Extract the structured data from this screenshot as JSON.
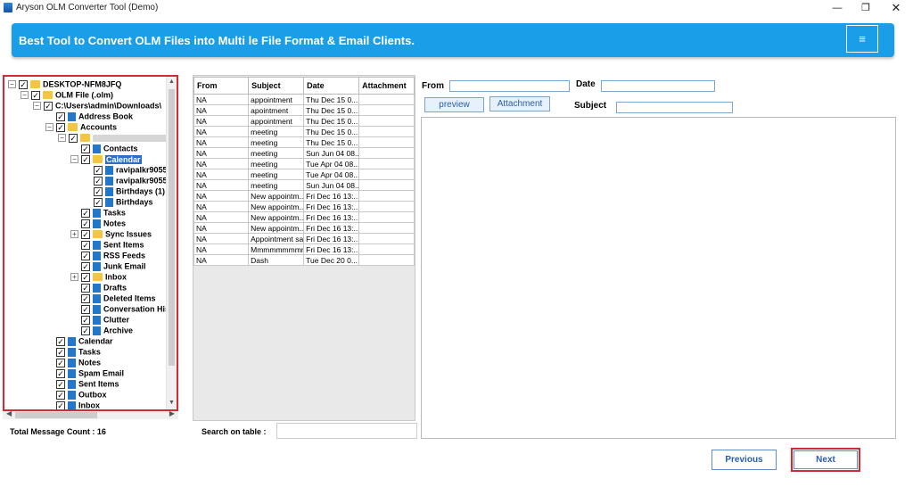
{
  "window": {
    "title": "Aryson OLM Converter Tool (Demo)",
    "minimize_glyph": "—",
    "maximize_glyph": "❐",
    "close_glyph": "✕"
  },
  "banner": {
    "text": "Best Tool to Convert OLM Files into Multi le File Format & Email Clients.",
    "menu_glyph": "≡"
  },
  "tree": {
    "nodes": [
      {
        "label": "DESKTOP-NFM8JFQ",
        "depth": 0,
        "expander": "minus",
        "icon": "folder-yellow",
        "checked": true
      },
      {
        "label": "OLM File (.olm)",
        "depth": 1,
        "expander": "minus",
        "icon": "folder-yellow",
        "checked": true
      },
      {
        "label": "C:\\Users\\admin\\Downloads\\",
        "depth": 2,
        "expander": "minus",
        "icon": "none",
        "checked": true
      },
      {
        "label": "Address Book",
        "depth": 3,
        "expander": "none",
        "icon": "folder-blue",
        "checked": true
      },
      {
        "label": "Accounts",
        "depth": 3,
        "expander": "minus",
        "icon": "folder-yellow",
        "checked": true
      },
      {
        "label": "",
        "depth": 4,
        "expander": "minus",
        "icon": "folder-yellow",
        "checked": true,
        "blurred": true
      },
      {
        "label": "Contacts",
        "depth": 5,
        "expander": "none",
        "icon": "folder-blue",
        "checked": true
      },
      {
        "label": "Calendar",
        "depth": 5,
        "expander": "minus",
        "icon": "folder-yellow",
        "checked": true,
        "selected": true
      },
      {
        "label": "ravipalkr9055",
        "depth": 6,
        "expander": "none",
        "icon": "folder-blue",
        "checked": true
      },
      {
        "label": "ravipalkr9055",
        "depth": 6,
        "expander": "none",
        "icon": "folder-blue",
        "checked": true
      },
      {
        "label": "Birthdays (1)",
        "depth": 6,
        "expander": "none",
        "icon": "folder-blue",
        "checked": true
      },
      {
        "label": "Birthdays",
        "depth": 6,
        "expander": "none",
        "icon": "folder-blue",
        "checked": true
      },
      {
        "label": "Tasks",
        "depth": 5,
        "expander": "none",
        "icon": "folder-blue",
        "checked": true
      },
      {
        "label": "Notes",
        "depth": 5,
        "expander": "none",
        "icon": "folder-blue",
        "checked": true
      },
      {
        "label": "Sync Issues",
        "depth": 5,
        "expander": "plus",
        "icon": "folder-yellow",
        "checked": true
      },
      {
        "label": "Sent Items",
        "depth": 5,
        "expander": "none",
        "icon": "folder-blue",
        "checked": true
      },
      {
        "label": "RSS Feeds",
        "depth": 5,
        "expander": "none",
        "icon": "folder-blue",
        "checked": true
      },
      {
        "label": "Junk Email",
        "depth": 5,
        "expander": "none",
        "icon": "folder-blue",
        "checked": true
      },
      {
        "label": "Inbox",
        "depth": 5,
        "expander": "plus",
        "icon": "folder-yellow",
        "checked": true
      },
      {
        "label": "Drafts",
        "depth": 5,
        "expander": "none",
        "icon": "folder-blue",
        "checked": true
      },
      {
        "label": "Deleted Items",
        "depth": 5,
        "expander": "none",
        "icon": "folder-blue",
        "checked": true
      },
      {
        "label": "Conversation Hist",
        "depth": 5,
        "expander": "none",
        "icon": "folder-blue",
        "checked": true
      },
      {
        "label": "Clutter",
        "depth": 5,
        "expander": "none",
        "icon": "folder-blue",
        "checked": true
      },
      {
        "label": "Archive",
        "depth": 5,
        "expander": "none",
        "icon": "folder-blue",
        "checked": true
      },
      {
        "label": "Calendar",
        "depth": 3,
        "expander": "none",
        "icon": "folder-blue",
        "checked": true
      },
      {
        "label": "Tasks",
        "depth": 3,
        "expander": "none",
        "icon": "folder-blue",
        "checked": true
      },
      {
        "label": "Notes",
        "depth": 3,
        "expander": "none",
        "icon": "folder-blue",
        "checked": true
      },
      {
        "label": "Spam Email",
        "depth": 3,
        "expander": "none",
        "icon": "folder-blue",
        "checked": true
      },
      {
        "label": "Sent Items",
        "depth": 3,
        "expander": "none",
        "icon": "folder-blue",
        "checked": true
      },
      {
        "label": "Outbox",
        "depth": 3,
        "expander": "none",
        "icon": "folder-blue",
        "checked": true
      },
      {
        "label": "Inbox",
        "depth": 3,
        "expander": "none",
        "icon": "folder-blue",
        "checked": true
      }
    ],
    "check_glyph": "✓",
    "minus_glyph": "−",
    "plus_glyph": "+",
    "scroll_up_glyph": "▲",
    "scroll_down_glyph": "▼",
    "scroll_left_glyph": "◀",
    "scroll_right_glyph": "▶"
  },
  "status": {
    "total_message_count": "Total Message Count : 16"
  },
  "messages": {
    "columns": [
      "From",
      "Subject",
      "Date",
      "Attachment"
    ],
    "rows": [
      [
        "NA",
        "appointment",
        "Thu Dec 15 0...",
        ""
      ],
      [
        "NA",
        "apointment",
        "Thu Dec 15 0...",
        ""
      ],
      [
        "NA",
        "appointment",
        "Thu Dec 15 0...",
        ""
      ],
      [
        "NA",
        "meeting",
        "Thu Dec 15 0...",
        ""
      ],
      [
        "NA",
        "meeting",
        "Thu Dec 15 0...",
        ""
      ],
      [
        "NA",
        "meeting",
        "Sun Jun 04 08...",
        ""
      ],
      [
        "NA",
        "meeting",
        "Tue Apr 04 08...",
        ""
      ],
      [
        "NA",
        "meeting",
        "Tue Apr 04 08...",
        ""
      ],
      [
        "NA",
        "meeting",
        "Sun Jun 04 08...",
        ""
      ],
      [
        "NA",
        "New appointm...",
        "Fri Dec 16 13:...",
        ""
      ],
      [
        "NA",
        "New appointm...",
        "Fri Dec 16 13:...",
        ""
      ],
      [
        "NA",
        "New appointm...",
        "Fri Dec 16 13:...",
        ""
      ],
      [
        "NA",
        "New appointm...",
        "Fri Dec 16 13:...",
        ""
      ],
      [
        "NA",
        "Appointment sat",
        "Fri Dec 16 13:...",
        ""
      ],
      [
        "NA",
        "Mmmmmmmmm",
        "Fri Dec 16 13:...",
        ""
      ],
      [
        "NA",
        "Dash",
        "Tue Dec 20 0...",
        ""
      ]
    ],
    "search_label": "Search on table :",
    "search_value": ""
  },
  "preview": {
    "from_label": "From",
    "date_label": "Date",
    "subject_label": "Subject",
    "from_value": "",
    "date_value": "",
    "subject_value": "",
    "preview_button": "preview",
    "attachment_button": "Attachment"
  },
  "navigation": {
    "previous_button": "Previous",
    "next_button": "Next"
  },
  "colors": {
    "banner": "#1a9ee8",
    "highlight_outline": "#d42a35",
    "selection": "#2b6ec9",
    "button_text": "#2a5ea8"
  }
}
